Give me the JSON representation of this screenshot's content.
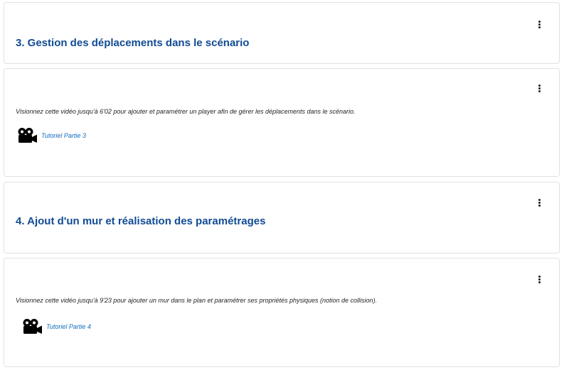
{
  "sections": [
    {
      "title": "3. Gestion des déplacements dans le scénario",
      "menu_icon": "kebab-menu-icon"
    },
    {
      "title": "4. Ajout d'un mur et réalisation des paramétrages",
      "menu_icon": "kebab-menu-icon"
    }
  ],
  "activities": [
    {
      "description": "Visionnez cette vidéo jusqu'à 6'02 pour ajouter et paramétrer un player afin de gérer les déplacements dans le scénario.",
      "link_label": "Tutoriel Partie 3",
      "icon": "video-camera-icon",
      "menu_icon": "kebab-menu-icon"
    },
    {
      "description": "Visionnez cette vidéo jusqu'à 9'23 pour ajouter un mur dans le plan et paramétrer ses propriétés physiques (notion de collision).",
      "link_label": "Tutoriel Partie 4",
      "icon": "video-camera-icon",
      "menu_icon": "kebab-menu-icon"
    }
  ],
  "colors": {
    "section_title": "#114b94",
    "link": "#0f6cbf",
    "border": "#dee2e6"
  }
}
